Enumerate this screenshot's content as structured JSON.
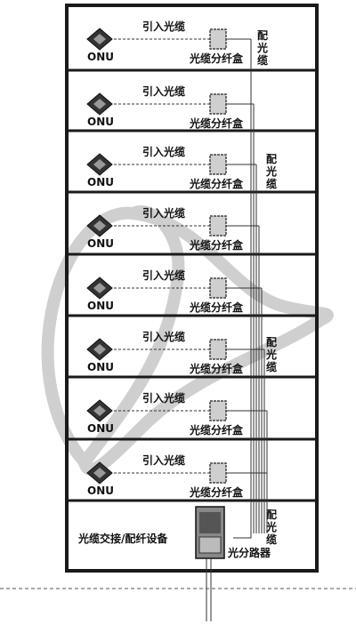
{
  "floors": [
    {
      "onu_label": "ONU",
      "drop_cable_label": "引入光缆",
      "splice_box_label": "光缆分纤盒"
    },
    {
      "onu_label": "ONU",
      "drop_cable_label": "引入光缆",
      "splice_box_label": "光缆分纤盒"
    },
    {
      "onu_label": "ONU",
      "drop_cable_label": "引入光缆",
      "splice_box_label": "光缆分纤盒"
    },
    {
      "onu_label": "ONU",
      "drop_cable_label": "引入光缆",
      "splice_box_label": "光缆分纤盒"
    },
    {
      "onu_label": "ONU",
      "drop_cable_label": "引入光缆",
      "splice_box_label": "光缆分纤盒"
    },
    {
      "onu_label": "ONU",
      "drop_cable_label": "引入光缆",
      "splice_box_label": "光缆分纤盒"
    },
    {
      "onu_label": "ONU",
      "drop_cable_label": "引入光缆",
      "splice_box_label": "光缆分纤盒"
    },
    {
      "onu_label": "ONU",
      "drop_cable_label": "引入光缆",
      "splice_box_label": "光缆分纤盒"
    }
  ],
  "distribution_cable_labels": [
    "配光缆",
    "配光缆",
    "配光缆",
    "配光缆"
  ],
  "basement": {
    "equipment_label": "光缆交接/配纤设备",
    "splitter_label": "光分路器"
  },
  "colors": {
    "frame": "#1a1a1a",
    "line": "#333333",
    "box_fill": "#cfcfcf",
    "watermark": "#9a9a9a"
  }
}
